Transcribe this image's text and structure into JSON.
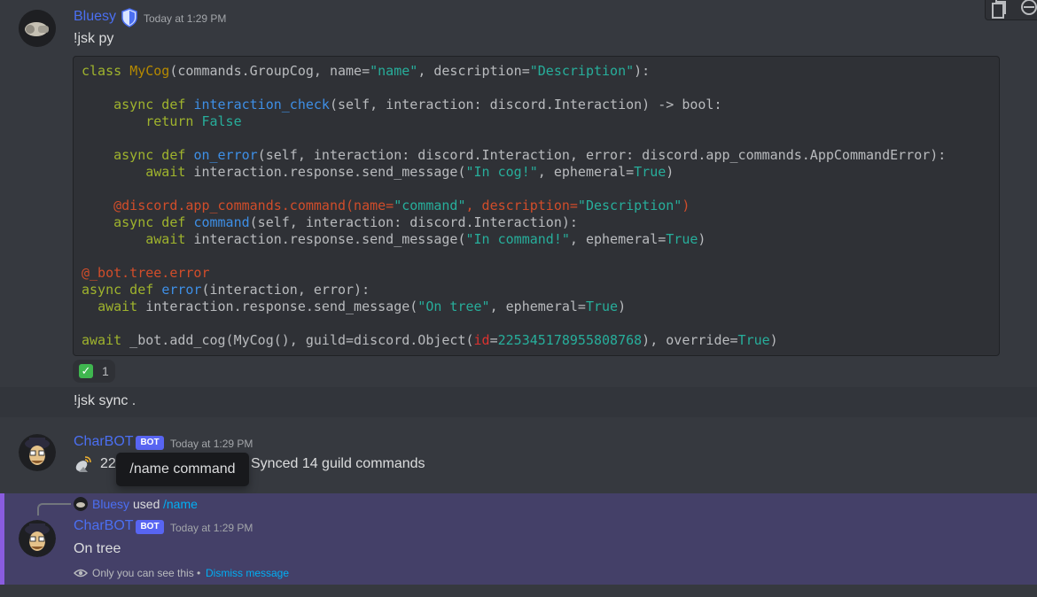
{
  "messages": {
    "m1": {
      "author": "Bluesy",
      "author_color": "#4b6ff2",
      "timestamp": "Today at 1:29 PM",
      "text": "!jsk py",
      "reaction_count": "1",
      "reaction_icon": "check-mark-icon"
    },
    "m2": {
      "text": "!jsk sync ."
    },
    "m3": {
      "author": "CharBOT",
      "author_color": "#4b6ff2",
      "badge": "BOT",
      "timestamp": "Today at 1:29 PM",
      "prefix_visible": "22",
      "text": "Synced 14 guild commands",
      "icon": "satellite-dish-icon"
    },
    "m4": {
      "reply_user": "Bluesy",
      "reply_used": "used",
      "reply_command": "/name",
      "author": "CharBOT",
      "badge": "BOT",
      "timestamp": "Today at 1:29 PM",
      "text": "On tree",
      "ephemeral_note": "Only you can see this •",
      "dismiss_label": "Dismiss message"
    }
  },
  "tooltip": {
    "text": "/name command"
  },
  "code_block": {
    "lines": [
      "class MyCog(commands.GroupCog, name=\"name\", description=\"Description\"):",
      "",
      "    async def interaction_check(self, interaction: discord.Interaction) -> bool:",
      "        return False",
      "",
      "    async def on_error(self, interaction: discord.Interaction, error: discord.app_commands.AppCommandError):",
      "        await interaction.response.send_message(\"In cog!\", ephemeral=True)",
      "",
      "    @discord.app_commands.command(name=\"command\", description=\"Description\")",
      "    async def command(self, interaction: discord.Interaction):",
      "        await interaction.response.send_message(\"In command!\", ephemeral=True)",
      "",
      "@_bot.tree.error",
      "async def error(interaction, error):",
      "  await interaction.response.send_message(\"On tree\", ephemeral=True)",
      "",
      "await _bot.add_cog(MyCog(), guild=discord.Object(id=225345178955808768), override=True)"
    ]
  },
  "colors": {
    "background": "#36393f",
    "ephemeral_bg": "#444068",
    "bot_badge": "#5865f2",
    "link": "#00aff4"
  }
}
